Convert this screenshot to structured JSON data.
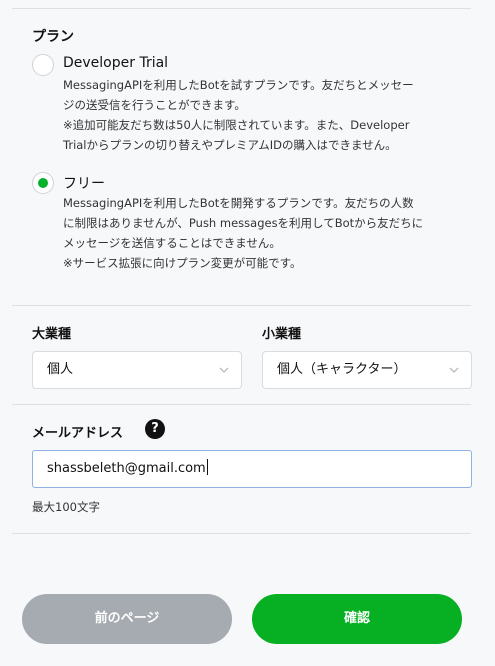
{
  "plan": {
    "title": "プラン",
    "options": [
      {
        "name": "Developer Trial",
        "selected": false,
        "desc": [
          "MessagingAPIを利用したBotを試すプランです。友だちとメッセー",
          "ジの送受信を行うことができます。",
          "※追加可能友だち数は50人に制限されています。また、Developer",
          "Trialからプランの切り替えやプレミアムIDの購入はできません。"
        ]
      },
      {
        "name": "フリー",
        "selected": true,
        "desc": [
          "MessagingAPIを利用したBotを開発するプランです。友だちの人数",
          "に制限はありませんが、Push messagesを利用してBotから友だちに",
          "メッセージを送信することはできません。",
          "※サービス拡張に向けプラン変更が可能です。"
        ]
      }
    ]
  },
  "industry": {
    "major_label": "大業種",
    "major_value": "個人",
    "minor_label": "小業種",
    "minor_value": "個人（キャラクター）"
  },
  "email": {
    "label": "メールアドレス",
    "help_glyph": "?",
    "value": "shassbeleth@gmail.com",
    "hint": "最大100文字"
  },
  "buttons": {
    "prev_label": "前のページ",
    "confirm_label": "確認"
  },
  "colors": {
    "accent_green": "#06b022",
    "prev_gray": "#a5abb1",
    "input_focus_border": "#8fb2e3"
  },
  "icons": {
    "select_arrow": "chevron-down-icon",
    "help": "question-circle-icon"
  }
}
